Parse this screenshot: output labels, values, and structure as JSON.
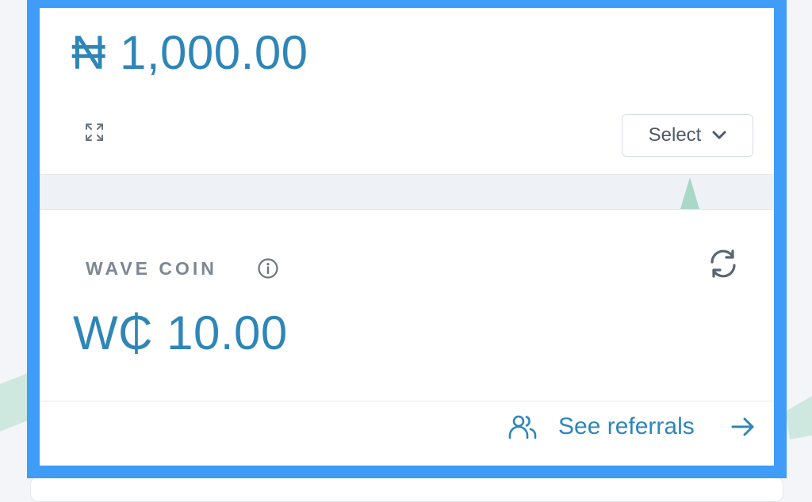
{
  "wallet": {
    "naira_amount": "₦ 1,000.00",
    "select_label": "Select"
  },
  "wave_coin": {
    "label": "WAVE COIN",
    "amount": "W₵ 10.00"
  },
  "referrals": {
    "link_label": "See referrals"
  },
  "icons": {
    "expand": "expand-icon",
    "chevron": "chevron-down-icon",
    "info": "info-icon",
    "refresh": "refresh-icon",
    "users": "users-icon",
    "arrow": "arrow-right-icon"
  },
  "colors": {
    "accent": "#2e86b8",
    "highlight": "#3f9cf7",
    "muted_text": "#7c8792",
    "decor": "#a9d7c8"
  }
}
